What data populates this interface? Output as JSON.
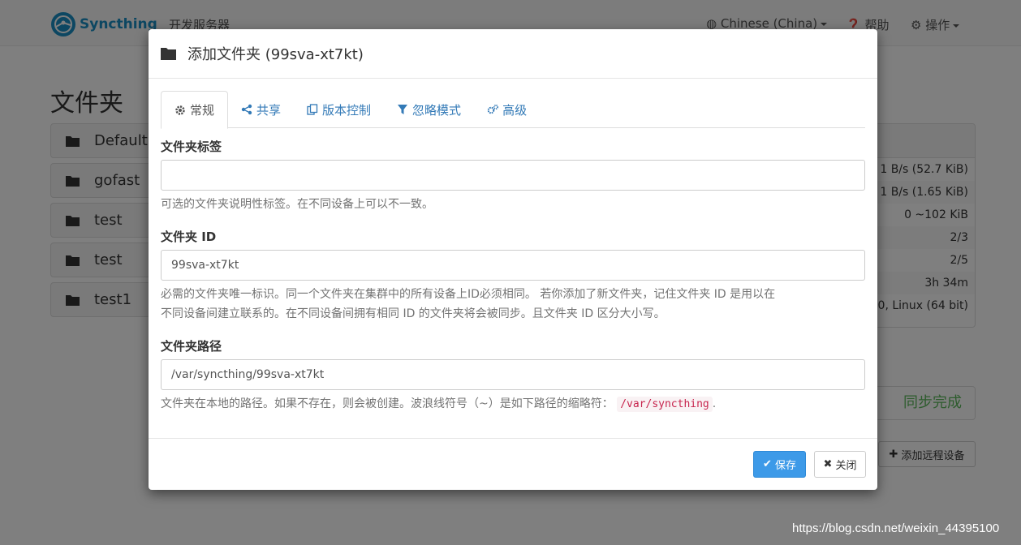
{
  "navbar": {
    "brand": "Syncthing",
    "server_link": "开发服务器",
    "language": "Chinese (China)",
    "help": "帮助",
    "actions": "操作"
  },
  "page": {
    "title": "文件夹",
    "folders": [
      "Default",
      "gofast",
      "test",
      "test",
      "test1"
    ],
    "device_stats": [
      "1 B/s (52.7 KiB)",
      "1 B/s (1.65 KiB)",
      "0  ~102 KiB",
      "2/3",
      "2/5",
      "3h 34m",
      ".0, Linux (64 bit)"
    ],
    "sync_status": "同步完成",
    "add_remote_device": "添加远程设备"
  },
  "modal": {
    "title": "添加文件夹 (99sva-xt7kt)",
    "tabs": [
      {
        "label": "常规",
        "icon": "gear-icon"
      },
      {
        "label": "共享",
        "icon": "share-icon"
      },
      {
        "label": "版本控制",
        "icon": "copy-icon"
      },
      {
        "label": "忽略模式",
        "icon": "filter-icon"
      },
      {
        "label": "高级",
        "icon": "cogs-icon"
      }
    ],
    "folder_label": {
      "label": "文件夹标签",
      "value": "",
      "help": "可选的文件夹说明性标签。在不同设备上可以不一致。"
    },
    "folder_id": {
      "label": "文件夹 ID",
      "value": "99sva-xt7kt",
      "help_line1": "必需的文件夹唯一标识。同一个文件夹在集群中的所有设备上ID必须相同。 若你添加了新文件夹，记住文件夹 ID 是用以在",
      "help_line2": "不同设备间建立联系的。在不同设备间拥有相同 ID 的文件夹将会被同步。且文件夹 ID 区分大小写。"
    },
    "folder_path": {
      "label": "文件夹路径",
      "value": "/var/syncthing/99sva-xt7kt",
      "help": "文件夹在本地的路径。如果不存在，则会被创建。波浪线符号（~）是如下路径的缩略符：",
      "help_code": "/var/syncthing",
      "help_end": "."
    },
    "save_label": "保存",
    "close_label": "关闭"
  },
  "watermark": "https://blog.csdn.net/weixin_44395100",
  "colors": {
    "primary": "#3d9ae8",
    "link": "#337ab7",
    "success": "#5cb85c",
    "brand": "#1a8fc4"
  }
}
